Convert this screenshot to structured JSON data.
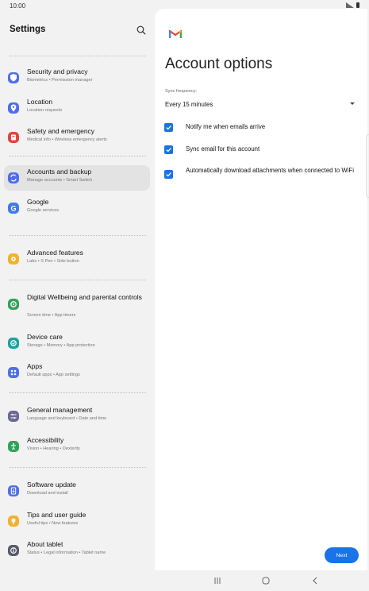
{
  "status": {
    "time": "10:00"
  },
  "settings": {
    "title": "Settings",
    "groups": [
      [
        {
          "title": "Security and privacy",
          "subtitle": "Biometrics  •  Permission manager",
          "icon": "shield-icon",
          "color": "#4f6fe8"
        },
        {
          "title": "Location",
          "subtitle": "Location requests",
          "icon": "location-pin-icon",
          "color": "#4f6fe8"
        },
        {
          "title": "Safety and emergency",
          "subtitle": "Medical info  •  Wireless emergency alerts",
          "icon": "emergency-icon",
          "color": "#e0463f"
        }
      ],
      [
        {
          "title": "Accounts and backup",
          "subtitle": "Manage accounts  •  Smart Switch",
          "icon": "sync-icon",
          "color": "#4f6fe8",
          "selected": true
        },
        {
          "title": "Google",
          "subtitle": "Google services",
          "icon": "google-icon",
          "color": "#3e7bf0"
        }
      ],
      [
        {
          "title": "Advanced features",
          "subtitle": "Labs  •  S Pen  •  Side button",
          "icon": "gear-plus-icon",
          "color": "#f3b132"
        }
      ],
      [
        {
          "title": "Digital Wellbeing and parental controls",
          "subtitle": "Screen time  •  App timers",
          "icon": "wellbeing-icon",
          "color": "#30a35a"
        },
        {
          "title": "Device care",
          "subtitle": "Storage  •  Memory  •  App protection",
          "icon": "device-care-icon",
          "color": "#1ba0a0"
        },
        {
          "title": "Apps",
          "subtitle": "Default apps  •  App settings",
          "icon": "apps-icon",
          "color": "#4f6fe8"
        }
      ],
      [
        {
          "title": "General management",
          "subtitle": "Language and keyboard  •  Date and time",
          "icon": "sliders-icon",
          "color": "#6a6a95"
        },
        {
          "title": "Accessibility",
          "subtitle": "Vision  •  Hearing  •  Dexterity",
          "icon": "accessibility-icon",
          "color": "#30a35a"
        }
      ],
      [
        {
          "title": "Software update",
          "subtitle": "Download and install",
          "icon": "software-update-icon",
          "color": "#4f6fe8"
        },
        {
          "title": "Tips and user guide",
          "subtitle": "Useful tips  •  New features",
          "icon": "bulb-icon",
          "color": "#f3b132"
        },
        {
          "title": "About tablet",
          "subtitle": "Status  •  Legal information  •  Tablet name",
          "icon": "info-icon",
          "color": "#5a5a6e"
        }
      ]
    ]
  },
  "account_options": {
    "heading": "Account options",
    "sync_label": "Sync frequency:",
    "sync_value": "Every 15 minutes",
    "checkboxes": [
      {
        "label": "Notify me when emails arrive",
        "checked": true
      },
      {
        "label": "Sync email for this account",
        "checked": true
      },
      {
        "label": "Automatically download attachments when connected to WiFi",
        "checked": true
      }
    ],
    "next_label": "Next"
  }
}
